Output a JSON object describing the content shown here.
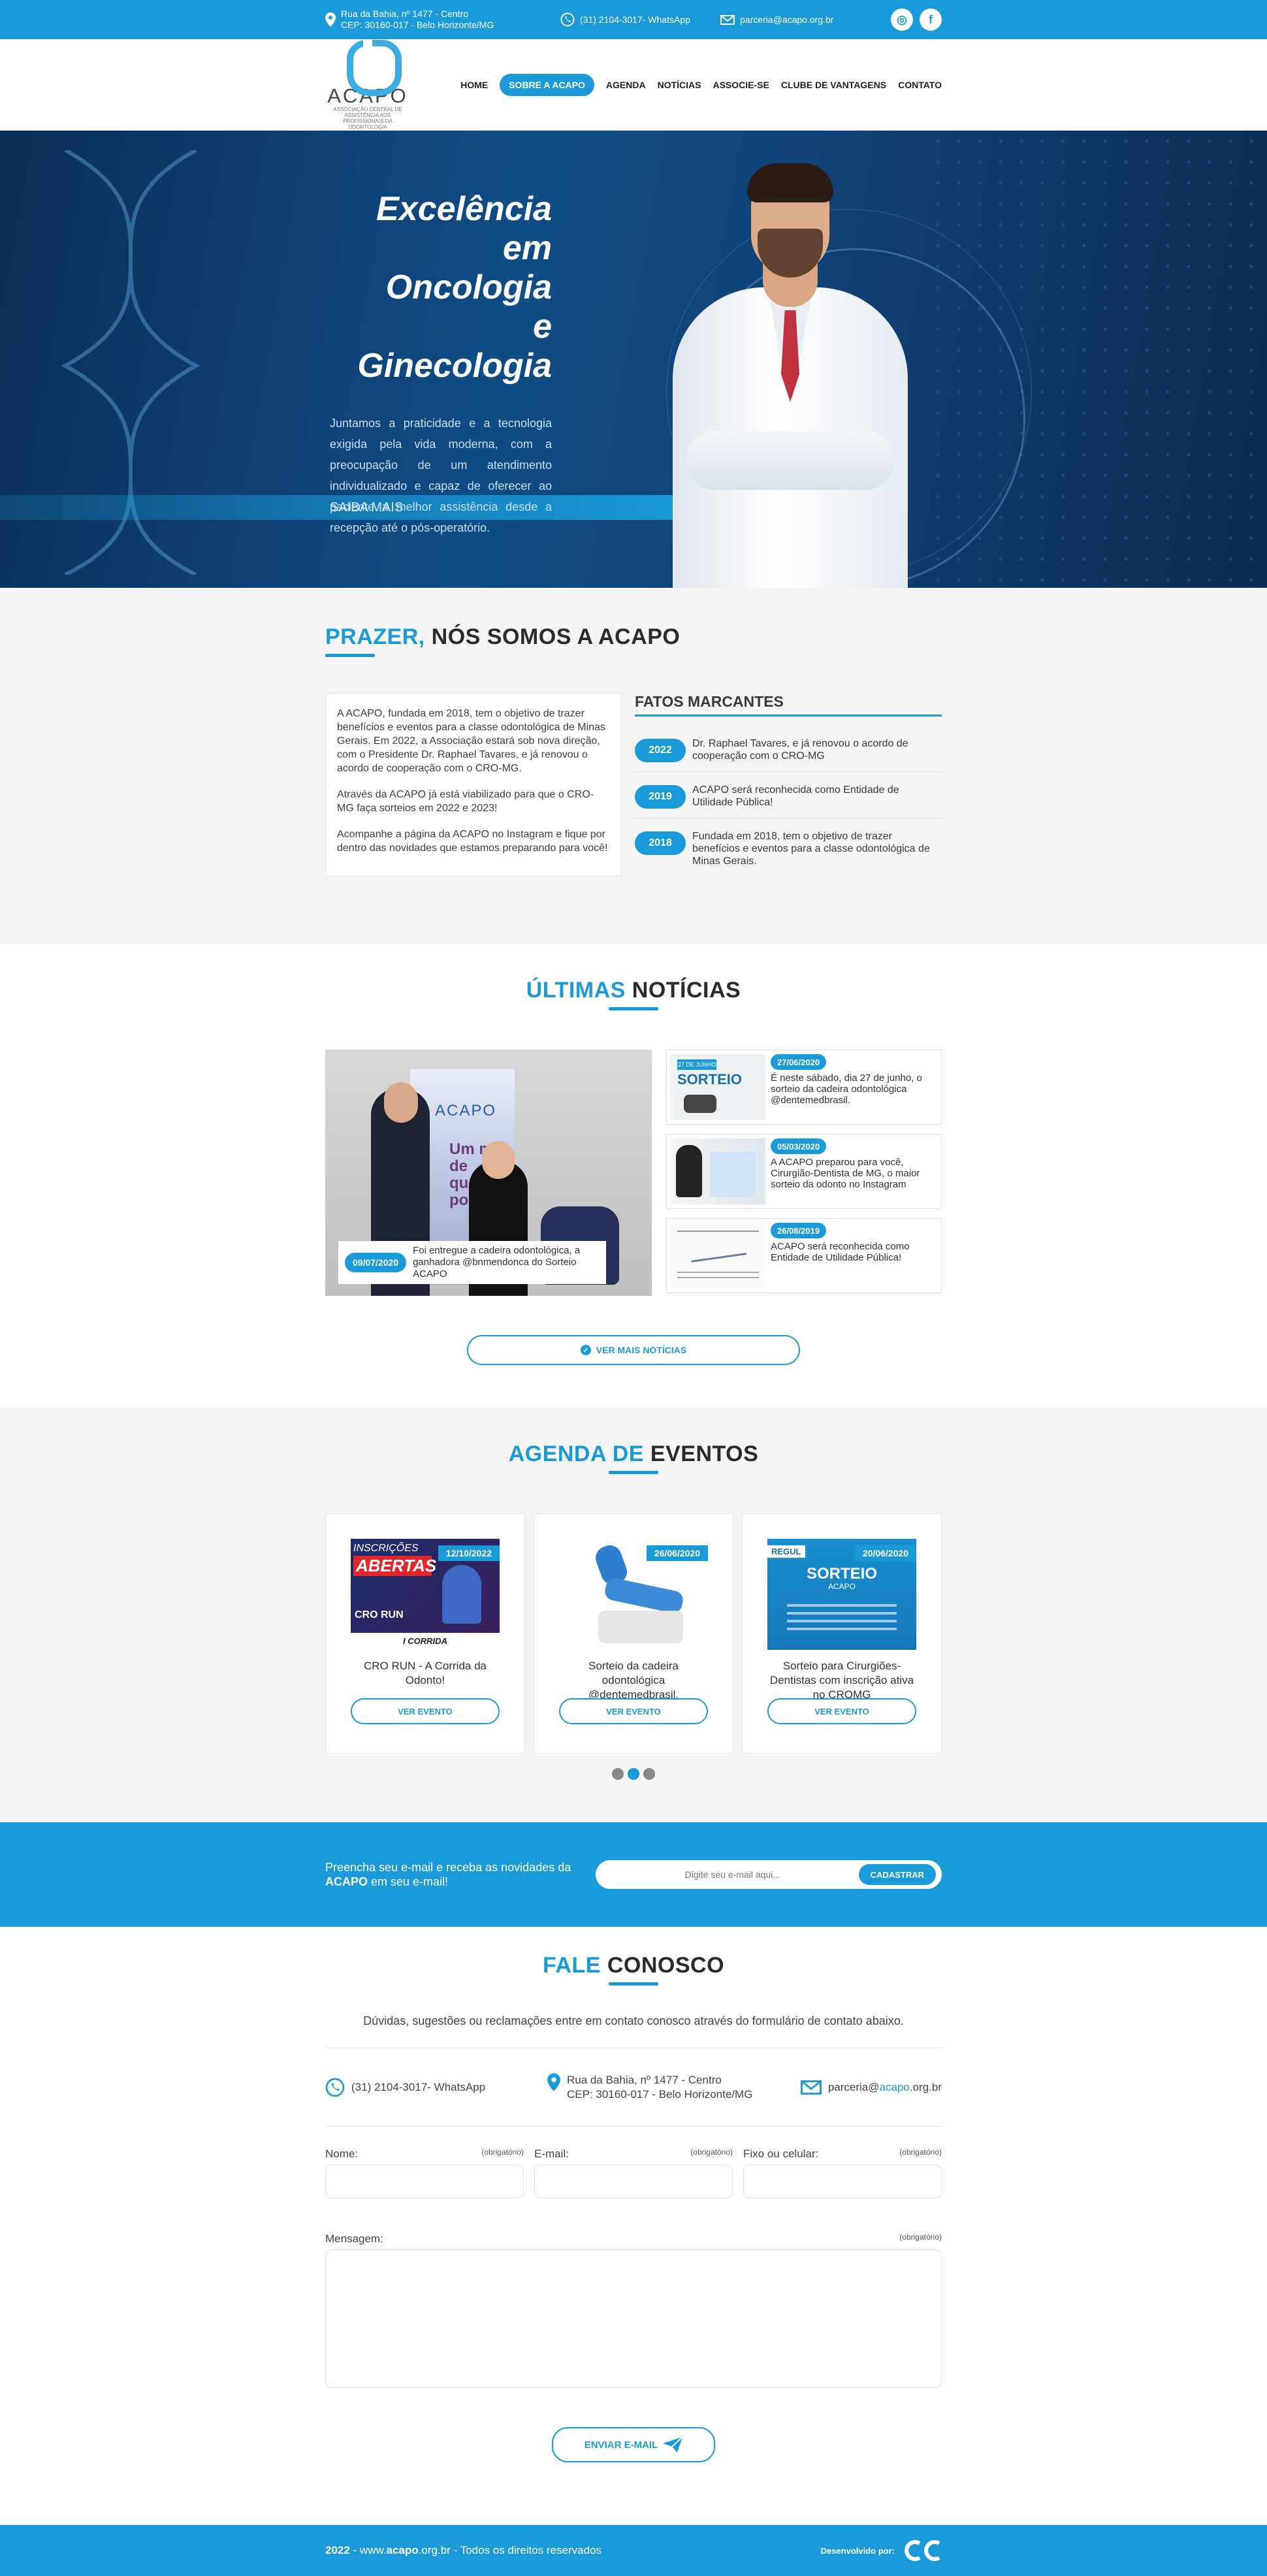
{
  "topbar": {
    "address_line1": "Rua da Bahia, nº 1477 - Centro",
    "address_line2": "CEP: 30160-017 - Belo Horizonte/MG",
    "whatsapp": "(31) 2104-3017- WhatsApp",
    "email": "parceria@acapo.org.br",
    "social": [
      "instagram-icon",
      "facebook-icon"
    ]
  },
  "logo": {
    "name": "ACAPO",
    "subtitle": "ASSOCIAÇÃO CENTRAL DE ASSISTÊNCIA AOS PROFISSIONAIS DA ODONTOLOGIA"
  },
  "nav": [
    "HOME",
    "SOBRE A ACAPO",
    "AGENDA",
    "NOTÍCIAS",
    "ASSOCIE-SE",
    "CLUBE DE VANTAGENS",
    "CONTATO"
  ],
  "hero": {
    "title_line1": "Excelência",
    "title_line2": "em Oncologia",
    "title_line3": "e Ginecologia",
    "text": "Juntamos a praticidade e a tecnologia exigida pela vida moderna, com a preocupação de um atendimento individualizado e capaz de oferecer ao paciente a melhor assistência desde a recepção até o pós-operatório.",
    "cta": "SAIBA MAIS"
  },
  "about": {
    "title_accent": "PRAZER,",
    "title_rest": " NÓS SOMOS A ACAPO",
    "p1": "A ACAPO, fundada em 2018, tem o objetivo de trazer benefícios e eventos para a classe odontológica de Minas Gerais. Em 2022, a Associação estará sob nova direção, com o Presidente Dr. Raphael Tavares, e já renovou o acordo de cooperação com o CRO-MG.",
    "p2": "Através da ACAPO já está viabilizado para que o CRO-MG faça sorteios em 2022 e 2023!",
    "p3": "Acompanhe a página da ACAPO no Instagram e fique por dentro das novidades que estamos preparando para você!",
    "fatos_title": "FATOS MARCANTES",
    "fatos": [
      {
        "year": "2022",
        "text": "Dr. Raphael Tavares, e já renovou o acordo de cooperação com o CRO-MG"
      },
      {
        "year": "2019",
        "text": "ACAPO será reconhecida como Entidade de Utilidade Pública!"
      },
      {
        "year": "2018",
        "text": "Fundada em 2018, tem o objetivo de trazer benefícios e eventos para a classe odontológica de Minas Gerais."
      }
    ]
  },
  "news": {
    "title_accent": "ÚLTIMAS",
    "title_rest": " NOTÍCIAS",
    "main": {
      "date": "09/07/2020",
      "text": "Foi entregue a cadeira odontológica, a ganhadora @bnmendonca do Sorteio ACAPO"
    },
    "items": [
      {
        "date": "27/06/2020",
        "text": "É neste sábado, dia 27 de junho, o sorteio da cadeira odontológica @dentemedbrasil."
      },
      {
        "date": "05/03/2020",
        "text": "A ACAPO preparou para você, Cirurgião-Dentista de MG, o maior sorteio da odonto no Instagram"
      },
      {
        "date": "26/08/2019",
        "text": "ACAPO será reconhecida como Entidade de Utilidade Pública!"
      }
    ],
    "thumb1_label": "SORTEIO",
    "thumb1_badge": "27 DE JUNHO",
    "more": "VER MAIS NOTÍCIAS"
  },
  "agenda": {
    "title_accent": "AGENDA DE",
    "title_rest": " EVENTOS",
    "events": [
      {
        "date": "12/10/2022",
        "title": "CRO RUN - A Corrida da Odonto!",
        "button": "VER EVENTO",
        "img_top": "INSCRIÇÕES",
        "img_main": "ABERTAS",
        "img_brand": "CRO RUN",
        "img_foot": "I CORRIDA"
      },
      {
        "date": "26/06/2020",
        "title": "Sorteio da cadeira odontológica @dentemedbrasil.",
        "button": "VER EVENTO"
      },
      {
        "date": "20/06/2020",
        "title": "Sorteio para Cirurgiões-Dentistas com inscrição ativa no CROMG",
        "button": "VER EVENTO",
        "img_main": "SORTEIO",
        "img_brand": "ACAPO",
        "img_top": "REGUL"
      }
    ]
  },
  "newsletter": {
    "text_pre": "Preencha seu e-mail e receba as novidades da ",
    "text_bold": "ACAPO",
    "text_post": " em seu e-mail!",
    "placeholder": "Digite seu e-mail aqui...",
    "button": "CADASTRAR"
  },
  "contact": {
    "title_accent": "FALE",
    "title_rest": " CONOSCO",
    "intro": "Dúvidas, sugestões ou reclamações entre em contato conosco através do formulário de contato abaixo.",
    "whatsapp": "(31) 2104-3017- WhatsApp",
    "address_line1": "Rua da Bahia, nº 1477 - Centro",
    "address_line2": "CEP: 30160-017 - Belo Horizonte/MG",
    "email_pre": "parceria@",
    "email_accent": "acapo",
    "email_post": ".org.br",
    "fields": {
      "name": "Nome:",
      "email": "E-mail:",
      "phone": "Fixo ou celular:",
      "message": "Mensagem:",
      "required": "(obrigatório)"
    },
    "send": "ENVIAR E-MAIL"
  },
  "footer": {
    "year": "2022",
    "url_pre": " - www.",
    "url_bold": "acapo",
    "url_post": ".org.br",
    "rights": "- Todos os direitos reservados",
    "dev_label": "Desenvolvido por:"
  }
}
